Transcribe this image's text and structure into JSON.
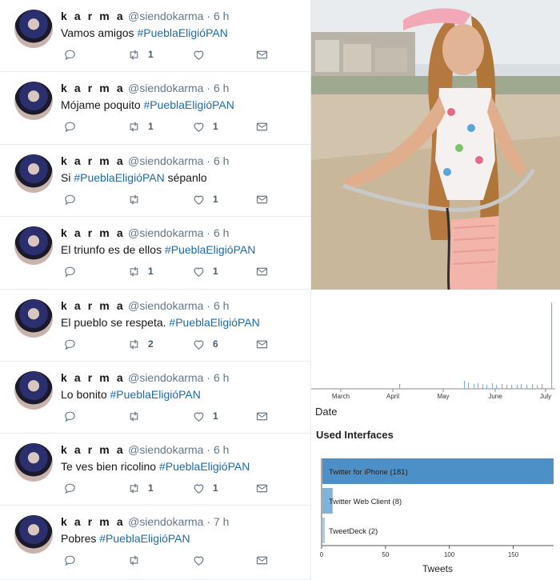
{
  "tweets": [
    {
      "username": "k a r m a",
      "handle": "@siendokarma",
      "time": "6 h",
      "text": "Vamos amigos ",
      "hashtag": "#PueblaEligióPAN",
      "text_after": "",
      "retweets": "1",
      "likes": ""
    },
    {
      "username": "k a r m a",
      "handle": "@siendokarma",
      "time": "6 h",
      "text": "Mójame poquito ",
      "hashtag": "#PueblaEligióPAN",
      "text_after": "",
      "retweets": "1",
      "likes": "1"
    },
    {
      "username": "k a r m a",
      "handle": "@siendokarma",
      "time": "6 h",
      "text": "Si ",
      "hashtag": "#PueblaEligióPAN",
      "text_after": " sépanlo",
      "retweets": "",
      "likes": "1"
    },
    {
      "username": "k a r m a",
      "handle": "@siendokarma",
      "time": "6 h",
      "text": "El triunfo es de ellos ",
      "hashtag": "#PueblaEligióPAN",
      "text_after": "",
      "retweets": "1",
      "likes": "1"
    },
    {
      "username": "k a r m a",
      "handle": "@siendokarma",
      "time": "6 h",
      "text": "El pueblo se respeta. ",
      "hashtag": "#PueblaEligióPAN",
      "text_after": "",
      "retweets": "2",
      "likes": "6"
    },
    {
      "username": "k a r m a",
      "handle": "@siendokarma",
      "time": "6 h",
      "text": "Lo bonito ",
      "hashtag": "#PueblaEligióPAN",
      "text_after": "",
      "retweets": "",
      "likes": "1"
    },
    {
      "username": "k a r m a",
      "handle": "@siendokarma",
      "time": "6 h",
      "text": "Te ves bien ricolino ",
      "hashtag": "#PueblaEligióPAN",
      "text_after": "",
      "retweets": "1",
      "likes": "1"
    },
    {
      "username": "k a r m a",
      "handle": "@siendokarma",
      "time": "7 h",
      "text": "Pobres ",
      "hashtag": "#PueblaEligióPAN",
      "text_after": "",
      "retweets": "",
      "likes": ""
    }
  ],
  "timeline": {
    "xlabel": "Date",
    "months": [
      "March",
      "April",
      "May",
      "June",
      "July"
    ]
  },
  "interfaces_title": "Used Interfaces",
  "chart_data": {
    "type": "bar",
    "orientation": "horizontal",
    "title": "Used Interfaces",
    "categories": [
      "Twitter for iPhone (181)",
      "Twitter Web Client (8)",
      "TweetDeck (2)"
    ],
    "values": [
      181,
      8,
      2
    ],
    "xlabel": "Tweets",
    "ylabel": "",
    "xlim": [
      0,
      181
    ],
    "xticks": [
      0,
      50,
      100,
      150
    ],
    "colors": [
      "#4d90c8",
      "#7fb3d9",
      "#a9cfe8"
    ]
  }
}
